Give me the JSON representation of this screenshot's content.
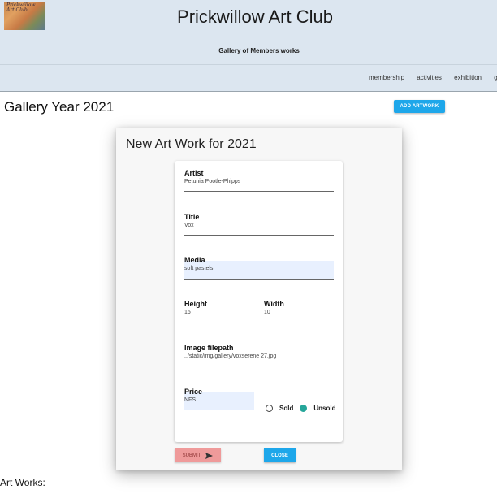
{
  "header": {
    "logo_text": "Prickwillow Art Club",
    "title": "Prickwillow Art Club",
    "subtitle": "Gallery of Members works",
    "nav": [
      "membership",
      "activities",
      "exhibition",
      "gall"
    ]
  },
  "main": {
    "page_title": "Gallery Year 2021",
    "add_button_label": "ADD ARTWORK",
    "artworks_label": "Art Works:"
  },
  "modal": {
    "title": "New Art Work for 2021",
    "fields": {
      "artist": {
        "label": "Artist",
        "value": "Petunia Pootle-Phipps"
      },
      "title": {
        "label": "Title",
        "value": "Vox"
      },
      "media": {
        "label": "Media",
        "value": "soft pastels"
      },
      "height": {
        "label": "Height",
        "value": "16"
      },
      "width": {
        "label": "Width",
        "value": "10"
      },
      "image": {
        "label": "Image filepath",
        "value": "../static/img/gallery/voxserene 27.jpg"
      },
      "price": {
        "label": "Price",
        "value": "NFS"
      }
    },
    "status_options": [
      {
        "label": "Sold",
        "selected": false
      },
      {
        "label": "Unsold",
        "selected": true
      }
    ],
    "submit_label": "SUBMIT",
    "close_label": "CLOSE"
  },
  "colors": {
    "header_bg": "#dce6f0",
    "accent_blue": "#1ea7ea",
    "submit_pink": "#ef9a9a",
    "radio_teal": "#26a69a",
    "field_highlight": "#e8f0fe"
  }
}
